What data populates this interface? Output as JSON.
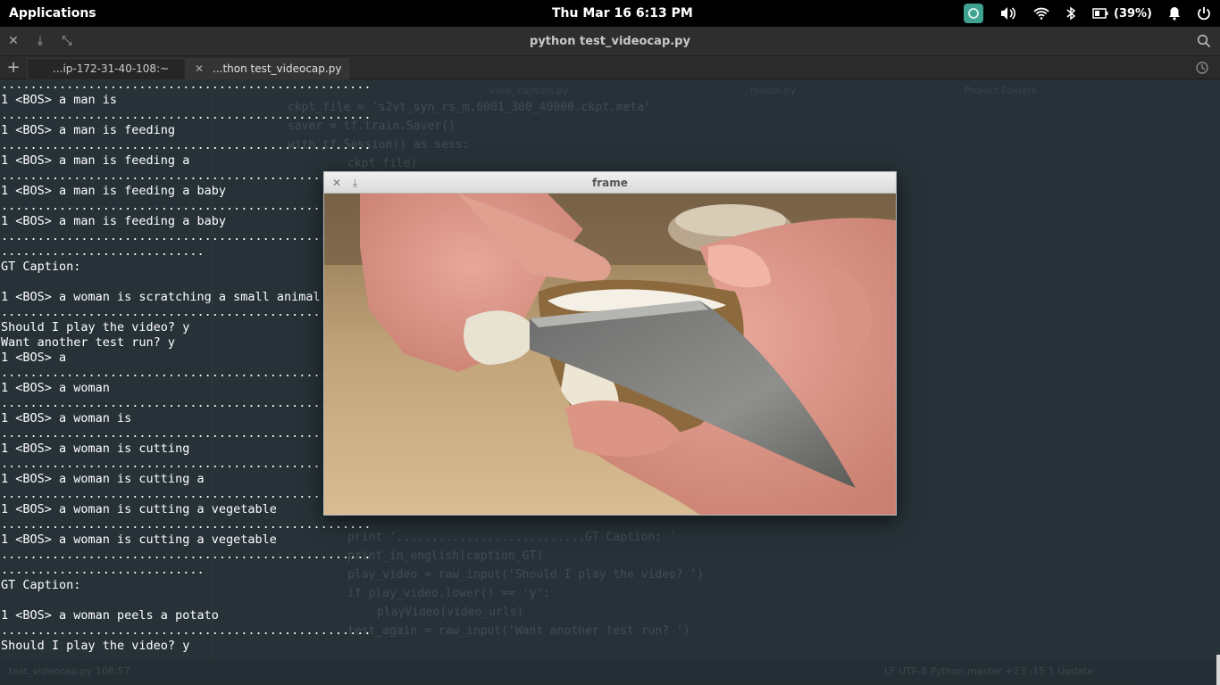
{
  "top_panel": {
    "applications_label": "Applications",
    "clock": "Thu Mar 16  6:13 PM",
    "battery_label": "(39%)",
    "icons": [
      "app-indicator-icon",
      "volume-icon",
      "wifi-icon",
      "bluetooth-icon",
      "battery-icon",
      "notification-bell-icon",
      "power-icon"
    ]
  },
  "terminal_window": {
    "title": "python test_videocap.py",
    "controls": [
      "close-icon",
      "download-icon",
      "unmaximize-icon"
    ],
    "tabs": [
      {
        "label": "...ip-172-31-40-108:~",
        "active": false
      },
      {
        "label": "...thon test_videocap.py",
        "active": true
      }
    ],
    "lines": [
      "...................................................",
      "1 <BOS> a man is",
      "...................................................",
      "1 <BOS> a man is feeding",
      "...................................................",
      "1 <BOS> a man is feeding a",
      "...................................................",
      "1 <BOS> a man is feeding a baby",
      "...................................................",
      "1 <BOS> a man is feeding a baby",
      "...................................................",
      "............................",
      "GT Caption:",
      "",
      "1 <BOS> a woman is scratching a small animal",
      "...................................................",
      "Should I play the video? y",
      "Want another test run? y",
      "1 <BOS> a",
      "...................................................",
      "1 <BOS> a woman",
      "...................................................",
      "1 <BOS> a woman is",
      "...................................................",
      "1 <BOS> a woman is cutting",
      "...................................................",
      "1 <BOS> a woman is cutting a",
      "...................................................",
      "1 <BOS> a woman is cutting a vegetable",
      "...................................................",
      "1 <BOS> a woman is cutting a vegetable",
      "...................................................",
      "............................",
      "GT Caption:",
      "",
      "1 <BOS> a woman peels a potato",
      "...................................................",
      "Should I play the video? y"
    ]
  },
  "frame_window": {
    "title": "frame",
    "controls": [
      "close-icon",
      "download-icon"
    ],
    "video_alt": "hands peeling a potato with a knife"
  },
  "colors": {
    "terminal_bg": "#263238",
    "panel_bg": "#000000",
    "text": "#ffffff"
  }
}
